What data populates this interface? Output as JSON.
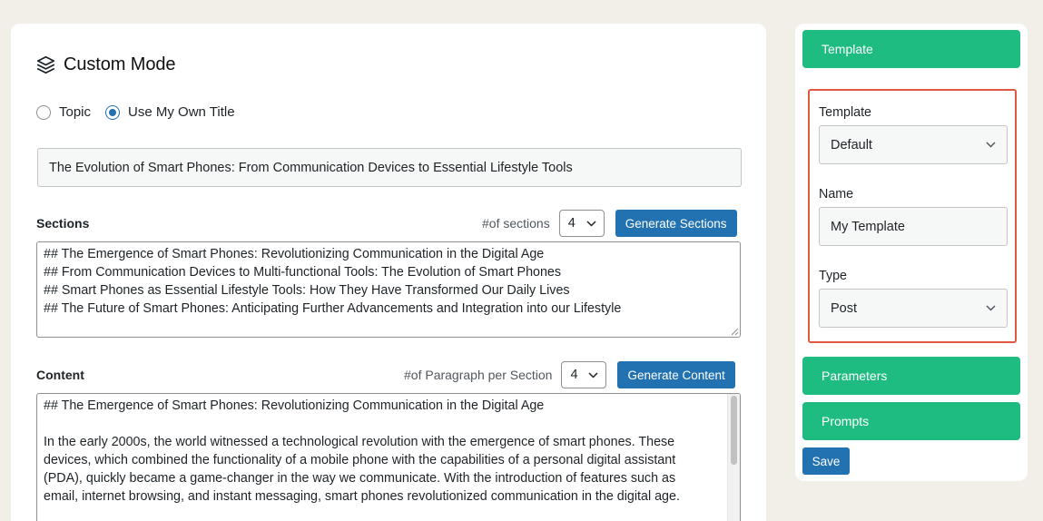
{
  "header": {
    "title": "Custom Mode",
    "icon": "layers-icon"
  },
  "mode": {
    "options": [
      {
        "label": "Topic",
        "checked": false
      },
      {
        "label": "Use My Own Title",
        "checked": true
      }
    ]
  },
  "title_input": {
    "value": "The Evolution of Smart Phones: From Communication Devices to Essential Lifestyle Tools"
  },
  "sections": {
    "label": "Sections",
    "count_label": "#of sections",
    "count_value": "4",
    "generate_label": "Generate Sections",
    "lines": [
      "## The Emergence of Smart Phones: Revolutionizing Communication in the Digital Age",
      "## From Communication Devices to Multi-functional Tools: The Evolution of Smart Phones",
      "## Smart Phones as Essential Lifestyle Tools: How They Have Transformed Our Daily Lives",
      "## The Future of Smart Phones: Anticipating Further Advancements and Integration into our Lifestyle"
    ]
  },
  "content": {
    "label": "Content",
    "count_label": "#of Paragraph per Section",
    "count_value": "4",
    "generate_label": "Generate Content",
    "lines": [
      "## The Emergence of Smart Phones: Revolutionizing Communication in the Digital Age",
      "",
      "In the early 2000s, the world witnessed a technological revolution with the emergence of smart phones. These",
      "devices, which combined the functionality of a mobile phone with the capabilities of a personal digital assistant",
      "(PDA), quickly became a game-changer in the way we communicate. With the introduction of features such as",
      "email, internet browsing, and instant messaging, smart phones revolutionized communication in the digital age."
    ]
  },
  "sidebar": {
    "template_header": "Template",
    "template_label": "Template",
    "template_value": "Default",
    "name_label": "Name",
    "name_value": "My Template",
    "type_label": "Type",
    "type_value": "Post",
    "parameters_label": "Parameters",
    "prompts_label": "Prompts",
    "save_label": "Save"
  },
  "colors": {
    "accent_blue": "#2271b1",
    "accent_green": "#1ebc81",
    "highlight_red": "#e25742",
    "page_bg": "#f1efe8"
  }
}
